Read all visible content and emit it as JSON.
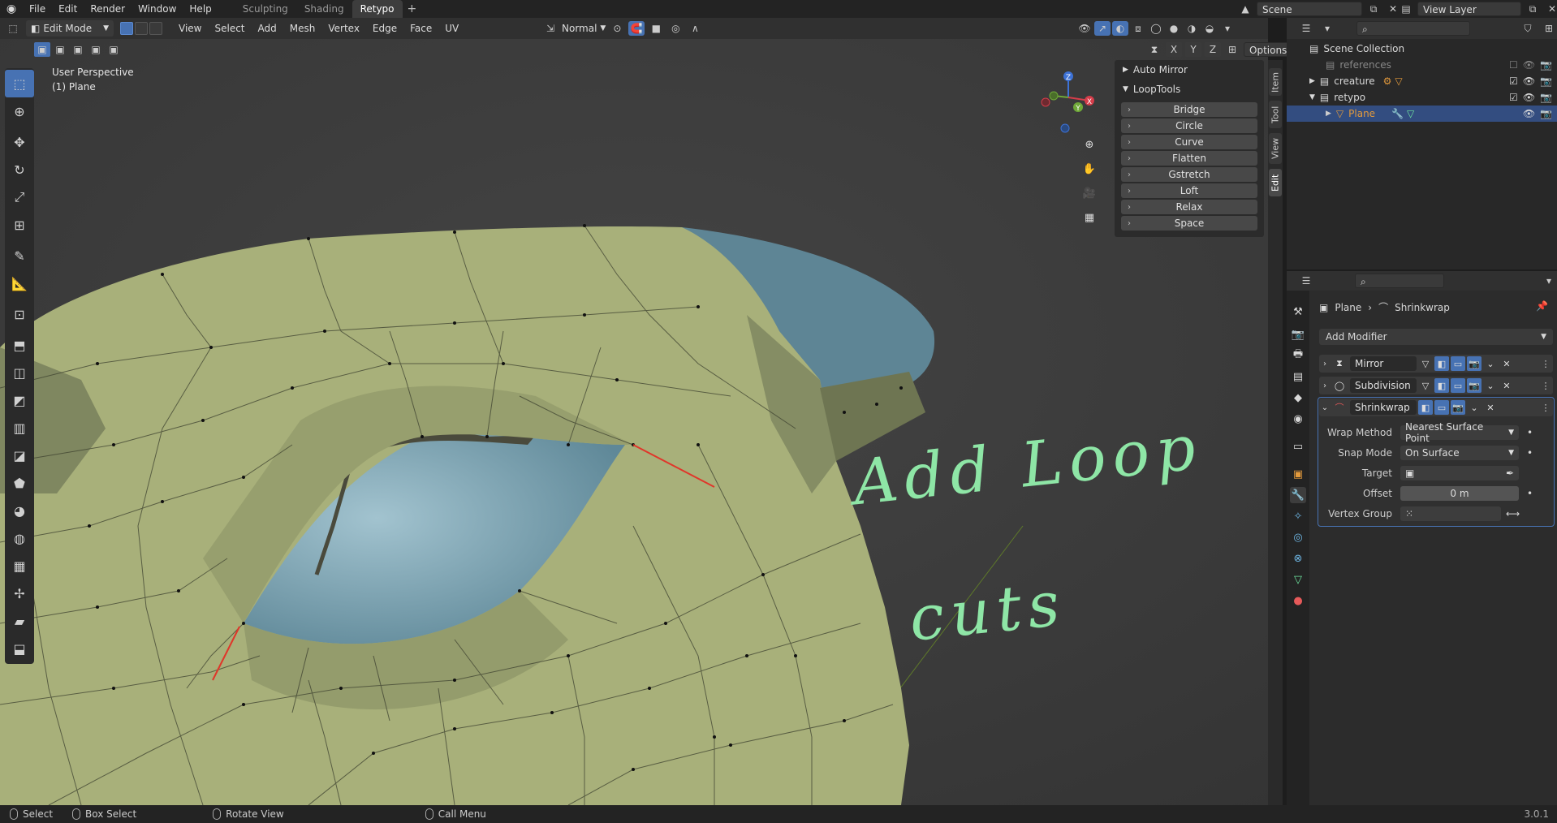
{
  "topbar": {
    "menus": [
      "File",
      "Edit",
      "Render",
      "Window",
      "Help"
    ],
    "workspaces": [
      "Sculpting",
      "Shading",
      "Retypo"
    ],
    "active_workspace": "Retypo",
    "scene": "Scene",
    "view_layer": "View Layer"
  },
  "viewport_header": {
    "mode": "Edit Mode",
    "menus": [
      "View",
      "Select",
      "Add",
      "Mesh",
      "Vertex",
      "Edge",
      "Face",
      "UV"
    ],
    "orientation": "Normal",
    "options": "Options",
    "axes": [
      "X",
      "Y",
      "Z"
    ]
  },
  "viewport": {
    "view_name": "User Perspective",
    "object_label": "(1) Plane",
    "annotation_line1": "Add Loop",
    "annotation_line2": "cuts"
  },
  "npanel": {
    "auto_mirror": "Auto Mirror",
    "looptools": "LoopTools",
    "buttons": [
      "Bridge",
      "Circle",
      "Curve",
      "Flatten",
      "Gstretch",
      "Loft",
      "Relax",
      "Space"
    ],
    "tabs": [
      "Item",
      "Tool",
      "View",
      "Edit"
    ],
    "active_tab": "Edit"
  },
  "outliner": {
    "root": "Scene Collection",
    "rows": [
      {
        "label": "references"
      },
      {
        "label": "creature"
      },
      {
        "label": "retypo"
      },
      {
        "label": "Plane"
      }
    ]
  },
  "properties": {
    "breadcrumb_object": "Plane",
    "breadcrumb_modifier": "Shrinkwrap",
    "add_modifier": "Add Modifier",
    "modifiers": [
      "Mirror",
      "Subdivision",
      "Shrinkwrap"
    ],
    "wrap_method_label": "Wrap Method",
    "wrap_method_value": "Nearest Surface Point",
    "snap_mode_label": "Snap Mode",
    "snap_mode_value": "On Surface",
    "target_label": "Target",
    "offset_label": "Offset",
    "offset_value": "0 m",
    "vertex_group_label": "Vertex Group"
  },
  "statusbar": {
    "select": "Select",
    "box_select": "Box Select",
    "rotate_view": "Rotate View",
    "call_menu": "Call Menu",
    "version": "3.0.1"
  },
  "colors": {
    "mesh_face": "#a8b07a",
    "mesh_face_dark": "#7f8760",
    "base_mesh": "#5e8595",
    "annotation": "#8ee6a6",
    "selected_edge": "#e0362a",
    "accent": "#4772b3"
  }
}
